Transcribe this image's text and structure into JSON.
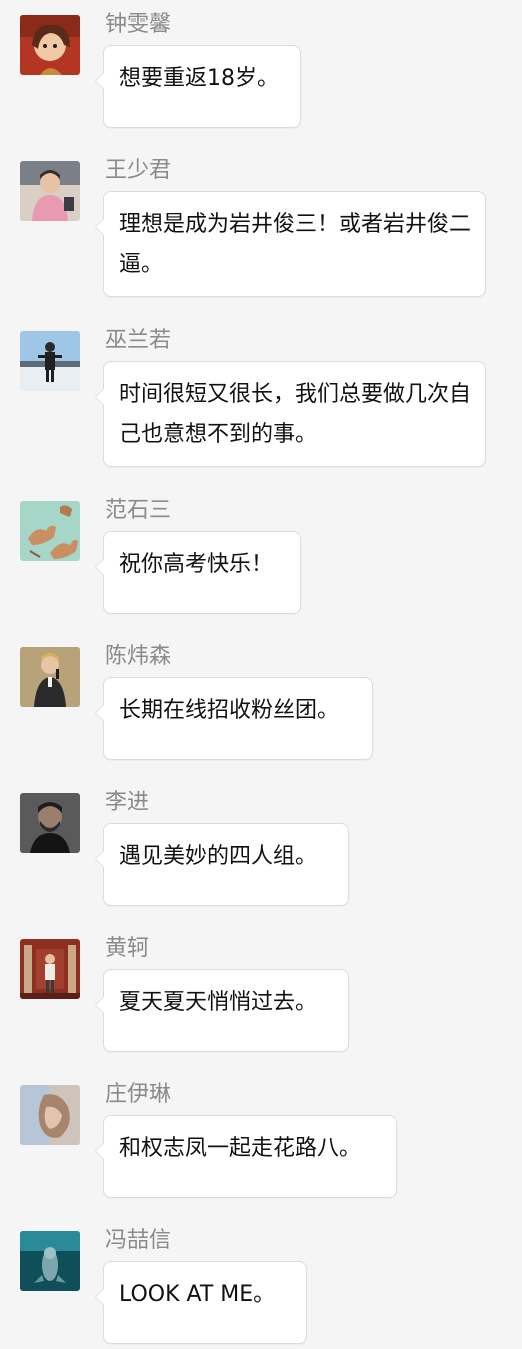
{
  "messages": [
    {
      "name": "钟雯馨",
      "text": "想要重返18岁。",
      "avatar_icon": "user-avatar-icon"
    },
    {
      "name": "王少君",
      "text": "理想是成为岩井俊三！或者岩井俊二逼。",
      "avatar_icon": "user-avatar-icon"
    },
    {
      "name": "巫兰若",
      "text": "时间很短又很长，我们总要做几次自己也意想不到的事。",
      "avatar_icon": "user-avatar-icon"
    },
    {
      "name": "范石三",
      "text": "祝你高考快乐！",
      "avatar_icon": "user-avatar-icon"
    },
    {
      "name": "陈炜森",
      "text": "长期在线招收粉丝团。",
      "avatar_icon": "user-avatar-icon"
    },
    {
      "name": "李进",
      "text": "遇见美妙的四人组。",
      "avatar_icon": "user-avatar-icon"
    },
    {
      "name": "黄轲",
      "text": "夏天夏天悄悄过去。",
      "avatar_icon": "user-avatar-icon"
    },
    {
      "name": "庄伊琳",
      "text": "和权志凤一起走花路八。",
      "avatar_icon": "user-avatar-icon"
    },
    {
      "name": "冯喆信",
      "text": "LOOK AT ME。",
      "avatar_icon": "user-avatar-icon"
    }
  ],
  "colors": {
    "background": "#f5f5f5",
    "bubble": "#ffffff",
    "bubble_border": "#dcdcdc",
    "name_text": "#8a8a8a",
    "message_text": "#111111"
  }
}
